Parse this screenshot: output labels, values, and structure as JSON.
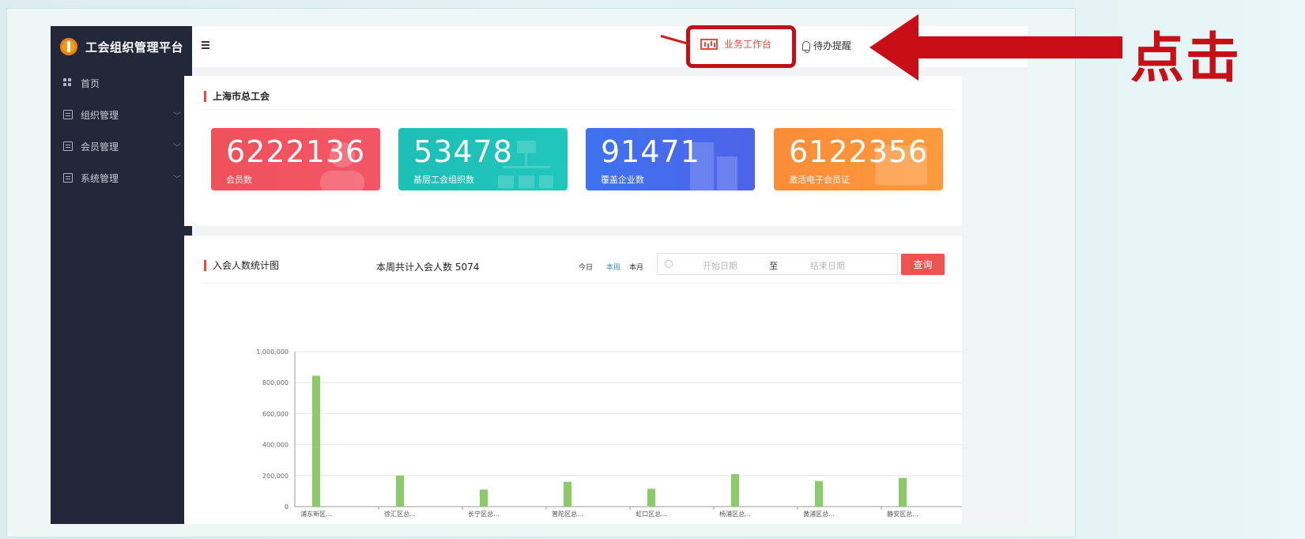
{
  "sidebar": {
    "title": "工会组织管理平台",
    "items": [
      {
        "label": "首页",
        "icon": "grid-icon",
        "expandable": false
      },
      {
        "label": "组织管理",
        "icon": "document-icon",
        "expandable": true
      },
      {
        "label": "会员管理",
        "icon": "document-icon",
        "expandable": true
      },
      {
        "label": "系统管理",
        "icon": "document-icon",
        "expandable": true
      }
    ]
  },
  "header": {
    "workbench_label": "业务工作台",
    "todo_label": "待办提醒"
  },
  "stats": {
    "title": "上海市总工会",
    "cards": [
      {
        "value": "6222136",
        "label": "会员数",
        "color": "#f0525a"
      },
      {
        "value": "53478",
        "label": "基层工会组织数",
        "color": "#1dbfb6"
      },
      {
        "value": "91471",
        "label": "覆盖企业数",
        "color": "#4a6cec"
      },
      {
        "value": "6122356",
        "label": "激活电子会员证",
        "color": "#fc9139"
      }
    ]
  },
  "chart_panel": {
    "title": "入会人数统计图",
    "week_total": "本周共计入会人数 5074",
    "ranges": [
      "今日",
      "本周",
      "本月"
    ],
    "active_range": "本周",
    "start_placeholder": "开始日期",
    "separator": "至",
    "end_placeholder": "结束日期",
    "query_label": "查询"
  },
  "chart_data": {
    "type": "bar",
    "categories": [
      "浦东新区...",
      "徐汇区总...",
      "长宁区总...",
      "普陀区总...",
      "虹口区总...",
      "杨浦区总...",
      "黄浦区总...",
      "静安区总..."
    ],
    "values": [
      845000,
      200000,
      110000,
      160000,
      115000,
      210000,
      165000,
      185000
    ],
    "yticks": [
      "0",
      "200,000",
      "400,000",
      "600,000",
      "800,000",
      "1,000,000"
    ],
    "ylim": [
      0,
      1000000
    ],
    "bar_color": "#8ccb6a",
    "grid": true
  },
  "annotation": {
    "label": "点击",
    "color": "#c80f18"
  }
}
